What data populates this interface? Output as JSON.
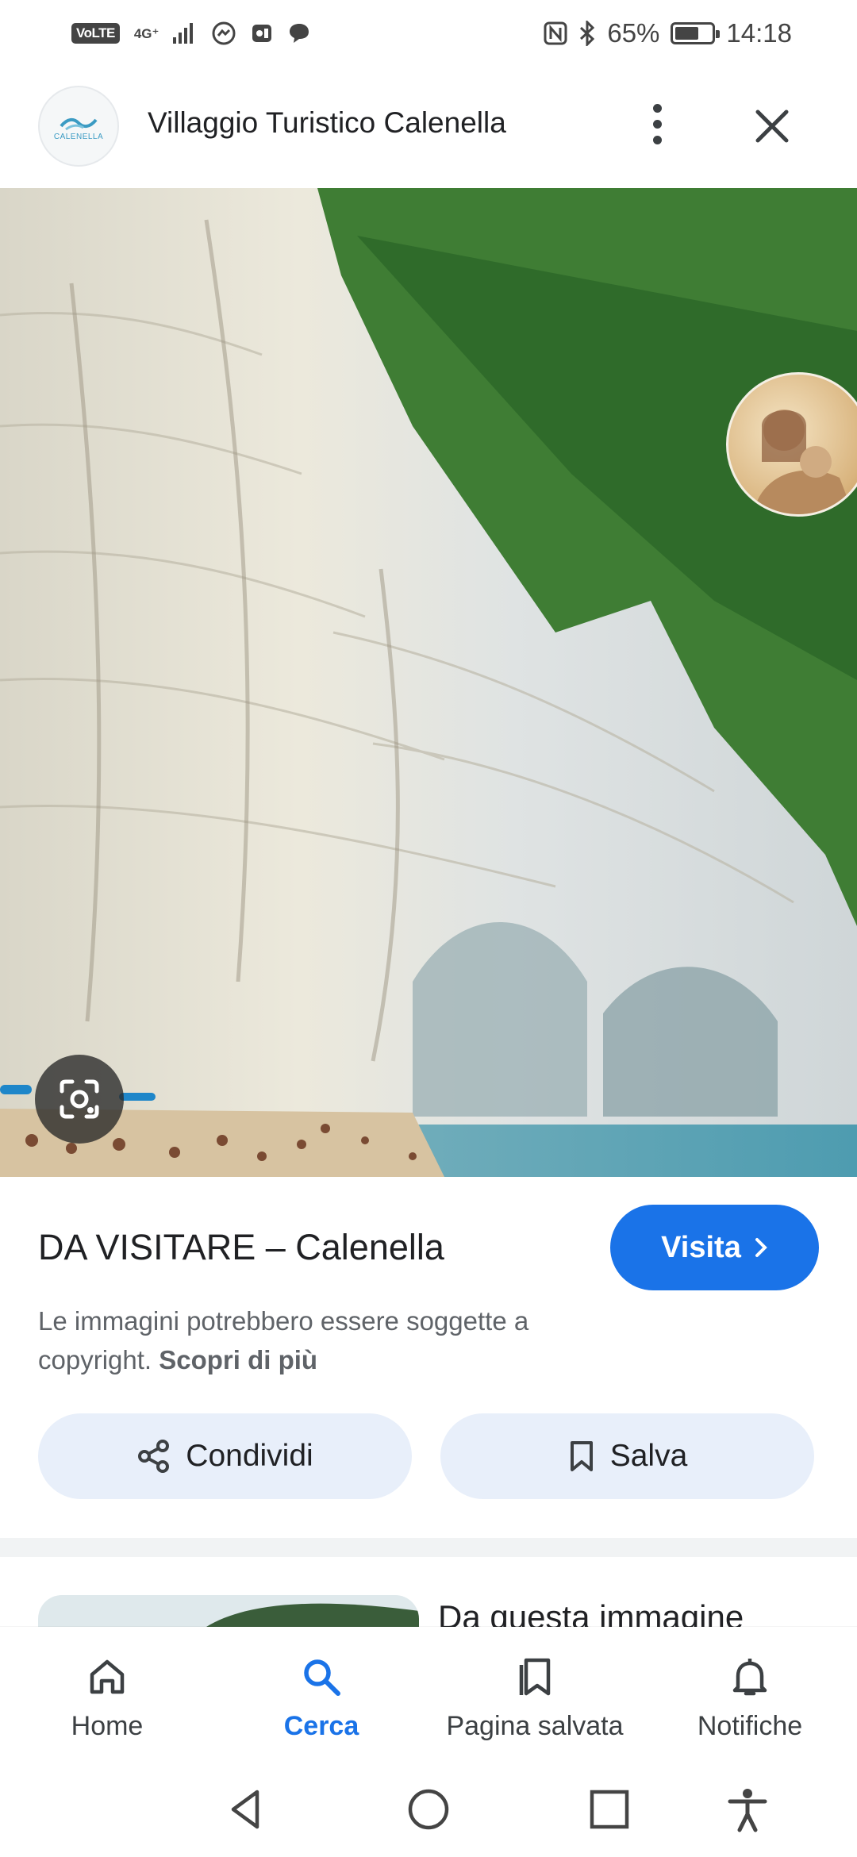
{
  "status_bar": {
    "volte": "VoLTE",
    "network": "4G⁺",
    "battery_percent": "65%",
    "battery_level": 0.65,
    "time": "14:18"
  },
  "header": {
    "site_title": "Villaggio Turistico Calenella",
    "logo_text": "CALENELLA"
  },
  "result": {
    "title": "DA VISITARE – Calenella",
    "visit_label": "Visita",
    "copyright_text": "Le immagini potrebbero essere soggette a copyright.",
    "learn_more": "Scopri di più",
    "share_label": "Condividi",
    "save_label": "Salva"
  },
  "related": {
    "title": "Da questa immagine"
  },
  "bottom_nav": {
    "items": [
      {
        "label": "Home",
        "icon": "home-icon"
      },
      {
        "label": "Cerca",
        "icon": "search-icon",
        "active": true
      },
      {
        "label": "Pagina salvata",
        "icon": "saved-page-icon"
      },
      {
        "label": "Notifiche",
        "icon": "bell-icon"
      }
    ]
  },
  "colors": {
    "accent": "#1a73e8",
    "pill_bg": "#e8effa",
    "sky": "#3a7fd8",
    "sea": "#5fa7b8"
  }
}
